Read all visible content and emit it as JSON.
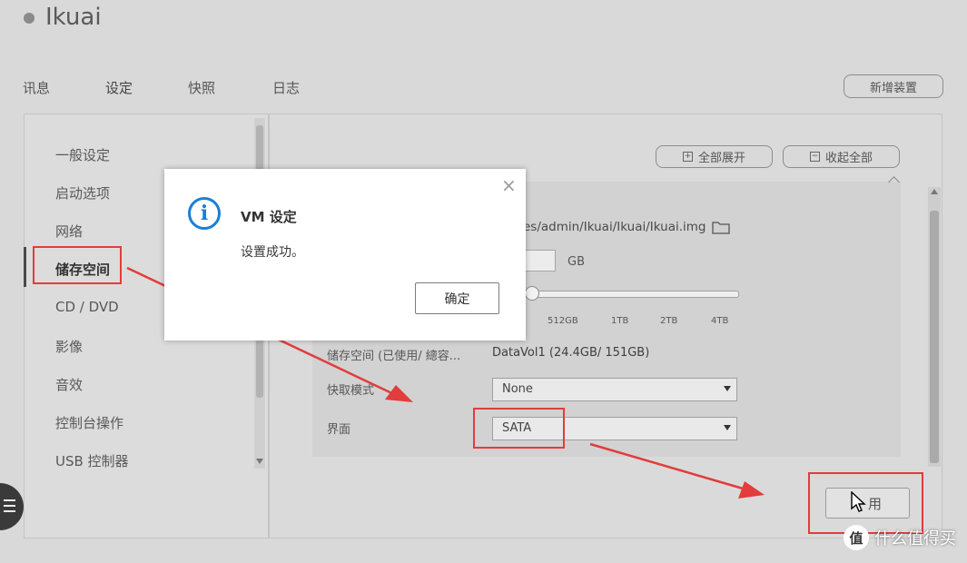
{
  "header": {
    "title": "Ikuai"
  },
  "tabs": [
    {
      "label": "讯息"
    },
    {
      "label": "设定"
    },
    {
      "label": "快照"
    },
    {
      "label": "日志"
    }
  ],
  "add_device_button": "新增装置",
  "sidebar": {
    "items": [
      {
        "label": "一般设定"
      },
      {
        "label": "启动选项"
      },
      {
        "label": "网络"
      },
      {
        "label": "储存空间"
      },
      {
        "label": "CD / DVD"
      },
      {
        "label": "影像"
      },
      {
        "label": "音效"
      },
      {
        "label": "控制台操作"
      },
      {
        "label": "USB 控制器"
      }
    ],
    "active_index": 3
  },
  "toolbar": {
    "expand_all": "全部展开",
    "collapse_all": "收起全部"
  },
  "storage": {
    "path_fragment": "es/admin/Ikuai/Ikuai/Ikuai.img",
    "size_unit": "GB",
    "slider_ticks": [
      "512GB",
      "1TB",
      "2TB",
      "4TB"
    ],
    "storage_label": "储存空间 (已使用/ 總容...",
    "storage_value": "DataVol1 (24.4GB/ 151GB)",
    "cache_label": "快取模式",
    "cache_value": "None",
    "interface_label": "界面",
    "interface_value": "SATA"
  },
  "apply_button": "用",
  "dialog": {
    "title": "VM 设定",
    "message": "设置成功。",
    "ok_label": "确定",
    "close_glyph": "×",
    "info_glyph": "i"
  },
  "watermark": {
    "logo": "值",
    "text": "什么值得买"
  },
  "colors": {
    "accent": "#1a7fd6",
    "annotation": "#e23c3c"
  }
}
